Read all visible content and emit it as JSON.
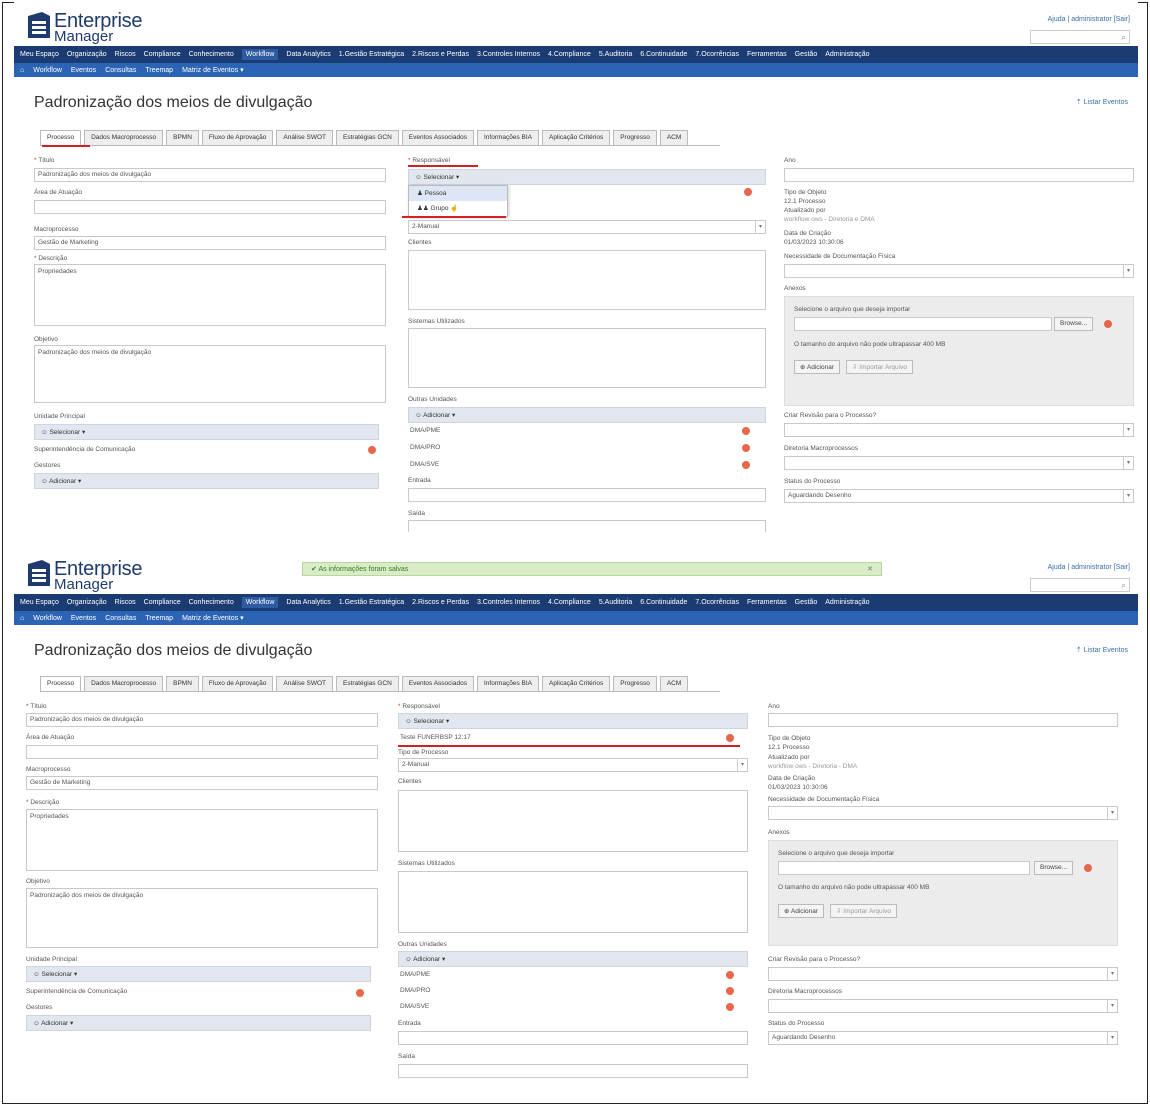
{
  "app": {
    "logo_line1": "Enterprise",
    "logo_line2": "Manager",
    "help_link": "Ajuda",
    "user_link": "administrator",
    "logout_link": "[Sair]",
    "nav_main": [
      "Meu Espaço",
      "Organização",
      "Riscos",
      "Compliance",
      "Conhecimento",
      "Workflow",
      "Data Analytics",
      "1.Gestão Estratégica",
      "2.Riscos e Perdas",
      "3.Controles Internos",
      "4.Compliance",
      "5.Auditoria",
      "6.Continuidade",
      "7.Ocorrências",
      "Ferramentas",
      "Gestão",
      "Administração"
    ],
    "nav_sub": [
      "Workflow",
      "Eventos",
      "Consultas",
      "Treemap",
      "Matriz de Eventos ▾"
    ],
    "list_events_link": "Listar Eventos",
    "brand_color": "#1b3c72",
    "accent_color": "#2c64b5",
    "highlight_color": "#d42020"
  },
  "shot_a": {
    "page_title": "Padronização dos meios de divulgação",
    "tabs": [
      "Processo",
      "Dados Macroprocesso",
      "BPMN",
      "Fluxo de Aprovação",
      "Análise SWOT",
      "Estratégias GCN",
      "Eventos Associados",
      "Informações BIA",
      "Aplicação Critérios",
      "Progresso",
      "ACM"
    ],
    "left": {
      "titulo_label": "Título",
      "titulo_value": "Padronização dos meios de divulgação",
      "area_label": "Área de Atuação",
      "macro_label": "Macroprocesso",
      "macro_value": "Gestão de Marketing",
      "descricao_label": "Descrição",
      "descricao_value": "Propriedades",
      "objetivo_label": "Objetivo",
      "objetivo_value": "Padronização dos meios de divulgação",
      "unidade_label": "Unidade Principal",
      "unidade_btn": "Selecionar ▾",
      "unidade_value": "Superintendência de Comunicação",
      "gestores_label": "Gestores",
      "gestores_btn": "Adicionar ▾"
    },
    "mid": {
      "responsavel_label": "Responsável",
      "responsavel_btn": "Selecionar ▾",
      "menu_items": [
        "Pessoa",
        "Grupo"
      ],
      "tipo_value": "2-Manual",
      "clientes_label": "Clientes",
      "sistemas_label": "Sistemas Utilizados",
      "outras_label": "Outras Unidades",
      "outras_btn": "Adicionar ▾",
      "unidades": [
        "DMA/PME",
        "DMA/PRO",
        "DMA/SVE"
      ],
      "entrada_label": "Entrada",
      "saida_label": "Saída"
    },
    "right": {
      "ano_label": "Ano",
      "tipo_obj_label": "Tipo de Objeto",
      "tipo_obj_value": "12.1 Processo",
      "atualizado_label": "Atualizado por",
      "atualizado_value": "workflow ows - Diretoria e DMA",
      "data_label": "Data de Criação",
      "data_value": "01/03/2023 10:30:06",
      "necessidade_label": "Necessidade de Documentação Física",
      "anexos_label": "Anexos",
      "anexos_hint": "Selecione o arquivo que deseja importar",
      "browse_btn": "Browse...",
      "size_note": "O tamanho do arquivo não pode ultrapassar 400 MB",
      "add_btn": "Adicionar",
      "import_btn": "Importar Arquivo",
      "revisao_label": "Criar Revisão para o Processo?",
      "diretoria_label": "Diretoria Macroprocessos",
      "status_label": "Status do Processo",
      "status_value": "Aguardando Desenho"
    }
  },
  "shot_b": {
    "notice": "As informações foram salvas",
    "page_title": "Padronização dos meios de divulgação",
    "tabs": [
      "Processo",
      "Dados Macroprocesso",
      "BPMN",
      "Fluxo de Aprovação",
      "Análise SWOT",
      "Estratégias GCN",
      "Eventos Associados",
      "Informações BIA",
      "Aplicação Critérios",
      "Progresso",
      "ACM"
    ],
    "left": {
      "titulo_label": "Título",
      "titulo_value": "Padronização dos meios de divulgação",
      "area_label": "Área de Atuação",
      "macro_label": "Macroprocesso",
      "macro_value": "Gestão de Marketing",
      "descricao_label": "Descrição",
      "descricao_value": "Propriedades",
      "objetivo_label": "Objetivo",
      "objetivo_value": "Padronização dos meios de divulgação",
      "unidade_label": "Unidade Principal",
      "unidade_btn": "Selecionar ▾",
      "unidade_value": "Superintendência de Comunicação",
      "gestores_label": "Gestores",
      "gestores_btn": "Adicionar ▾"
    },
    "mid": {
      "responsavel_label": "Responsável",
      "responsavel_btn": "Selecionar ▾",
      "responsavel_value": "Teste FUNERBSP 12:17",
      "tipo_label": "Tipo de Processo",
      "tipo_value": "2-Manual",
      "clientes_label": "Clientes",
      "sistemas_label": "Sistemas Utilizados",
      "outras_label": "Outras Unidades",
      "outras_btn": "Adicionar ▾",
      "unidades": [
        "DMA/PME",
        "DMA/PRO",
        "DMA/SVE"
      ],
      "entrada_label": "Entrada",
      "saida_label": "Saída"
    },
    "right": {
      "ano_label": "Ano",
      "tipo_obj_label": "Tipo de Objeto",
      "tipo_obj_value": "12.1 Processo",
      "atualizado_label": "Atualizado por",
      "atualizado_value": "workflow ows - Diretoria - DMA",
      "data_label": "Data de Criação",
      "data_value": "01/03/2023 10:30:06",
      "necessidade_label": "Necessidade de Documentação Física",
      "anexos_label": "Anexos",
      "anexos_hint": "Selecione o arquivo que deseja importar",
      "browse_btn": "Browse...",
      "size_note": "O tamanho do arquivo não pode ultrapassar 400 MB",
      "add_btn": "Adicionar",
      "import_btn": "Importar Arquivo",
      "revisao_label": "Criar Revisão para o Processo?",
      "diretoria_label": "Diretoria Macroprocessos",
      "status_label": "Status do Processo",
      "status_value": "Aguardando Desenho"
    }
  }
}
